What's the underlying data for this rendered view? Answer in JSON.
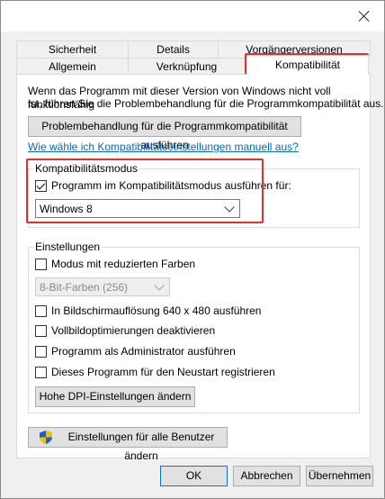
{
  "tabs": {
    "row1": [
      "Sicherheit",
      "Details",
      "Vorgängerversionen"
    ],
    "row2": [
      "Allgemein",
      "Verknüpfung",
      "Kompatibilität"
    ]
  },
  "intro": {
    "line1": "Wenn das Programm mit dieser Version von Windows nicht voll funktionsfähig",
    "line2": "ist, führen Sie die Problembehandlung für die Programmkompatibilität aus."
  },
  "troubleshoot_button": "Problembehandlung für die Programmkompatibilität ausführen",
  "manual_link": "Wie wähle ich Kompatibilitätseinstellungen manuell aus?",
  "compat_mode": {
    "title": "Kompatibilitätsmodus",
    "checkbox_label": "Programm im Kompatibilitätsmodus ausführen für:",
    "checked": true,
    "selected_os": "Windows 8"
  },
  "settings": {
    "title": "Einstellungen",
    "reduced_colors": "Modus mit reduzierten Farben",
    "color_depth": "8-Bit-Farben (256)",
    "res_640": "In Bildschirmauflösung 640 x 480 ausführen",
    "fullscreen_opt": "Vollbildoptimierungen deaktivieren",
    "run_admin": "Programm als Administrator ausführen",
    "restart_register": "Dieses Programm für den Neustart registrieren",
    "dpi_button": "Hohe DPI-Einstellungen ändern"
  },
  "all_users_button": "Einstellungen für alle Benutzer ändern",
  "footer": {
    "ok": "OK",
    "cancel": "Abbrechen",
    "apply": "Übernehmen"
  },
  "colors": {
    "highlight": "#e0312f",
    "link": "#0066cc",
    "default_border": "#0078d7"
  }
}
